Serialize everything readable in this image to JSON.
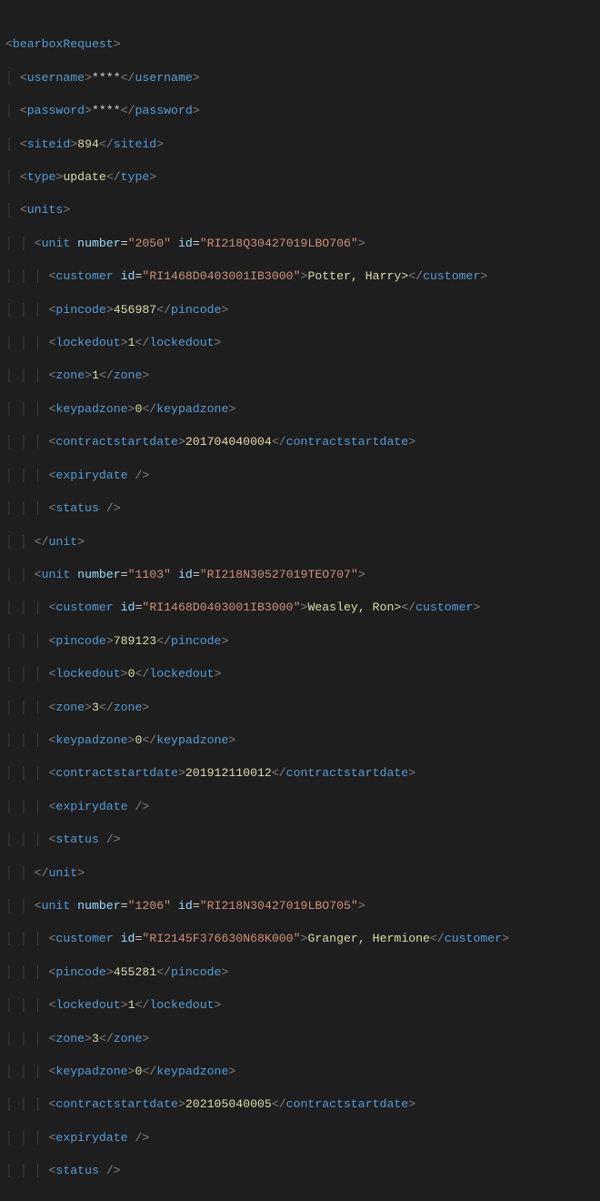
{
  "root": {
    "tag": "bearboxRequest"
  },
  "username": {
    "tag": "username",
    "value": "****"
  },
  "password": {
    "tag": "password",
    "value": "****"
  },
  "siteid": {
    "tag": "siteid",
    "value": "894"
  },
  "type": {
    "tag": "type",
    "value": "update"
  },
  "units": {
    "tag": "units"
  },
  "unit": [
    {
      "tag": "unit",
      "attr_number": "number",
      "number": "2050",
      "attr_id": "id",
      "id": "RI218Q30427019LBO706",
      "customer": {
        "tag": "customer",
        "attr_id": "id",
        "id": "RI1468D0403001IB3000",
        "value": "Potter, Harry>"
      },
      "pincode": {
        "tag": "pincode",
        "value": "456987"
      },
      "lockedout": {
        "tag": "lockedout",
        "value": "1"
      },
      "zone": {
        "tag": "zone",
        "value": "1"
      },
      "keypadzone": {
        "tag": "keypadzone",
        "value": "0"
      },
      "contractstartdate": {
        "tag": "contractstartdate",
        "value": "201704040004"
      },
      "expirydate": {
        "tag": "expirydate"
      },
      "status": {
        "tag": "status"
      }
    },
    {
      "tag": "unit",
      "attr_number": "number",
      "number": "1103",
      "attr_id": "id",
      "id": "RI218N30527019TEO707",
      "customer": {
        "tag": "customer",
        "attr_id": "id",
        "id": "RI1468D0403001IB3000",
        "value": "Weasley, Ron>"
      },
      "pincode": {
        "tag": "pincode",
        "value": "789123"
      },
      "lockedout": {
        "tag": "lockedout",
        "value": "0"
      },
      "zone": {
        "tag": "zone",
        "value": "3"
      },
      "keypadzone": {
        "tag": "keypadzone",
        "value": "0"
      },
      "contractstartdate": {
        "tag": "contractstartdate",
        "value": "201912110012"
      },
      "expirydate": {
        "tag": "expirydate"
      },
      "status": {
        "tag": "status"
      }
    },
    {
      "tag": "unit",
      "attr_number": "number",
      "number": "1206",
      "attr_id": "id",
      "id": "RI218N30427019LBO705",
      "customer": {
        "tag": "customer",
        "attr_id": "id",
        "id": "RI2145F376630N68K000",
        "value": "Granger, Hermione"
      },
      "pincode": {
        "tag": "pincode",
        "value": "455281"
      },
      "lockedout": {
        "tag": "lockedout",
        "value": "1"
      },
      "zone": {
        "tag": "zone",
        "value": "3"
      },
      "keypadzone": {
        "tag": "keypadzone",
        "value": "0"
      },
      "contractstartdate": {
        "tag": "contractstartdate",
        "value": "202105040005"
      },
      "expirydate": {
        "tag": "expirydate"
      },
      "status": {
        "tag": "status"
      }
    }
  ]
}
